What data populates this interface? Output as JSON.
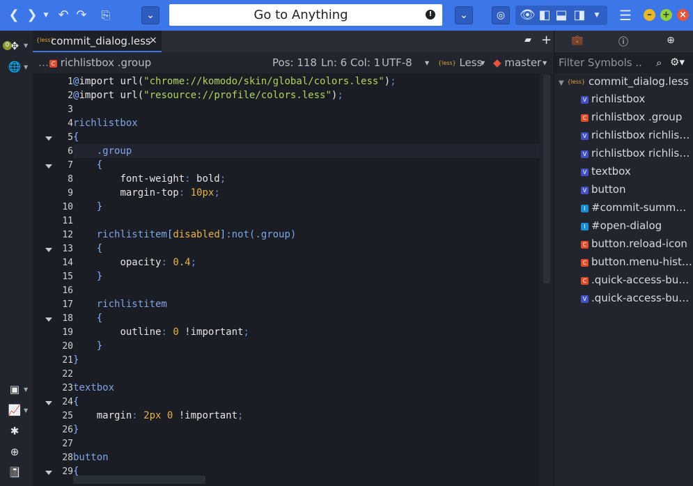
{
  "toolbar": {
    "goto_label": "Go to Anything",
    "warn_glyph": "!"
  },
  "tab": {
    "less_badge": "{less}",
    "filename": "commit_dialog.less",
    "close": "×"
  },
  "infobar": {
    "breadcrumb": "richlistbox .group",
    "pos": "Pos: 118",
    "ln_col": "Ln: 6 Col: 1",
    "encoding": "UTF-8",
    "language": "Less",
    "branch": "master"
  },
  "rail": {
    "badge": "0"
  },
  "gutter": [
    "1",
    "2",
    "3",
    "4",
    "5",
    "6",
    "7",
    "8",
    "9",
    "10",
    "11",
    "12",
    "13",
    "14",
    "15",
    "16",
    "17",
    "18",
    "19",
    "20",
    "21",
    "22",
    "23",
    "24",
    "25",
    "26",
    "27",
    "28",
    "29"
  ],
  "fold_lines": [
    5,
    7,
    13,
    18,
    24,
    29
  ],
  "code": [
    [
      [
        "at",
        "@"
      ],
      [
        "plain",
        "import "
      ],
      [
        "plain",
        "url("
      ],
      [
        "str",
        "\"chrome://komodo/skin/global/colors.less\""
      ],
      [
        "plain",
        ")"
      ],
      [
        "col",
        ";"
      ]
    ],
    [
      [
        "at",
        "@"
      ],
      [
        "plain",
        "import "
      ],
      [
        "plain",
        "url("
      ],
      [
        "str",
        "\"resource://profile/colors.less\""
      ],
      [
        "plain",
        ")"
      ],
      [
        "col",
        ";"
      ]
    ],
    [],
    [
      [
        "sel",
        "richlistbox"
      ]
    ],
    [
      [
        "pun",
        "{"
      ]
    ],
    [
      [
        "plain",
        "    "
      ],
      [
        "sel",
        ".group"
      ]
    ],
    [
      [
        "plain",
        "    "
      ],
      [
        "pun",
        "{"
      ]
    ],
    [
      [
        "plain",
        "        "
      ],
      [
        "prop",
        "font-weight"
      ],
      [
        "col",
        ": "
      ],
      [
        "plain",
        "bold"
      ],
      [
        "col",
        ";"
      ]
    ],
    [
      [
        "plain",
        "        "
      ],
      [
        "prop",
        "margin-top"
      ],
      [
        "col",
        ": "
      ],
      [
        "num",
        "10px"
      ],
      [
        "col",
        ";"
      ]
    ],
    [
      [
        "plain",
        "    "
      ],
      [
        "pun",
        "}"
      ]
    ],
    [],
    [
      [
        "plain",
        "    "
      ],
      [
        "sel",
        "richlistitem"
      ],
      [
        "pun",
        "["
      ],
      [
        "num",
        "disabled"
      ],
      [
        "pun",
        "]"
      ],
      [
        "sel",
        ":not(.group)"
      ]
    ],
    [
      [
        "plain",
        "    "
      ],
      [
        "pun",
        "{"
      ]
    ],
    [
      [
        "plain",
        "        "
      ],
      [
        "prop",
        "opacity"
      ],
      [
        "col",
        ": "
      ],
      [
        "num",
        "0.4"
      ],
      [
        "col",
        ";"
      ]
    ],
    [
      [
        "plain",
        "    "
      ],
      [
        "pun",
        "}"
      ]
    ],
    [],
    [
      [
        "plain",
        "    "
      ],
      [
        "sel",
        "richlistitem"
      ]
    ],
    [
      [
        "plain",
        "    "
      ],
      [
        "pun",
        "{"
      ]
    ],
    [
      [
        "plain",
        "        "
      ],
      [
        "prop",
        "outline"
      ],
      [
        "col",
        ": "
      ],
      [
        "num",
        "0"
      ],
      [
        "plain",
        " !important"
      ],
      [
        "col",
        ";"
      ]
    ],
    [
      [
        "plain",
        "    "
      ],
      [
        "pun",
        "}"
      ]
    ],
    [
      [
        "pun",
        "}"
      ]
    ],
    [],
    [
      [
        "sel",
        "textbox"
      ]
    ],
    [
      [
        "pun",
        "{"
      ]
    ],
    [
      [
        "plain",
        "    "
      ],
      [
        "prop",
        "margin"
      ],
      [
        "col",
        ": "
      ],
      [
        "num",
        "2px"
      ],
      [
        "plain",
        " "
      ],
      [
        "num",
        "0"
      ],
      [
        "plain",
        " !important"
      ],
      [
        "col",
        ";"
      ]
    ],
    [
      [
        "pun",
        "}"
      ]
    ],
    [],
    [
      [
        "sel",
        "button"
      ]
    ],
    [
      [
        "pun",
        "{"
      ]
    ]
  ],
  "symbols": {
    "filter_placeholder": "Filter Symbols ..",
    "root": "commit_dialog.less",
    "items": [
      {
        "kind": "V",
        "label": "richlistbox"
      },
      {
        "kind": "C",
        "label": "richlistbox .group"
      },
      {
        "kind": "V",
        "label": "richlistbox richlistit..."
      },
      {
        "kind": "V",
        "label": "richlistbox richlistit..."
      },
      {
        "kind": "V",
        "label": "textbox"
      },
      {
        "kind": "V",
        "label": "button"
      },
      {
        "kind": "I",
        "label": "#commit-summary"
      },
      {
        "kind": "I",
        "label": "#open-dialog"
      },
      {
        "kind": "C",
        "label": "button.reload-icon"
      },
      {
        "kind": "C",
        "label": "button.menu-histo..."
      },
      {
        "kind": "C",
        "label": ".quick-access-butt..."
      },
      {
        "kind": "V",
        "label": ".quick-access-butt..."
      }
    ]
  },
  "colors": {
    "toolbar": "#3d76e6",
    "editor_bg": "#1b1d24",
    "accent": "#3d76e6"
  }
}
